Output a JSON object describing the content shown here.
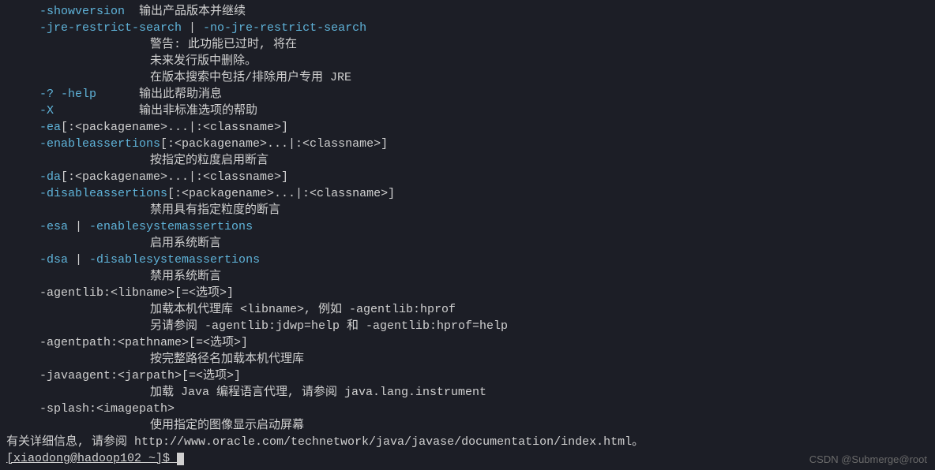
{
  "lines": [
    {
      "cls": "indent1",
      "parts": [
        {
          "c": "opt",
          "t": "-showversion"
        },
        {
          "c": "norm",
          "t": "  输出产品版本并继续"
        }
      ]
    },
    {
      "cls": "indent1",
      "parts": [
        {
          "c": "opt",
          "t": "-jre-restrict-search"
        },
        {
          "c": "norm",
          "t": " | "
        },
        {
          "c": "opt",
          "t": "-no-jre-restrict-search"
        }
      ]
    },
    {
      "cls": "indent2",
      "parts": [
        {
          "c": "norm",
          "t": "警告: 此功能已过时, 将在"
        }
      ]
    },
    {
      "cls": "indent2",
      "parts": [
        {
          "c": "norm",
          "t": "未来发行版中删除。"
        }
      ]
    },
    {
      "cls": "indent2",
      "parts": [
        {
          "c": "norm",
          "t": "在版本搜索中包括/排除用户专用 JRE"
        }
      ]
    },
    {
      "cls": "indent1",
      "parts": [
        {
          "c": "opt",
          "t": "-? -help"
        },
        {
          "c": "norm",
          "t": "      输出此帮助消息"
        }
      ]
    },
    {
      "cls": "indent1",
      "parts": [
        {
          "c": "opt",
          "t": "-X"
        },
        {
          "c": "norm",
          "t": "            输出非标准选项的帮助"
        }
      ]
    },
    {
      "cls": "indent1",
      "parts": [
        {
          "c": "opt",
          "t": "-ea"
        },
        {
          "c": "norm",
          "t": "[:<packagename>...|:<classname>]"
        }
      ]
    },
    {
      "cls": "indent1",
      "parts": [
        {
          "c": "opt",
          "t": "-enableassertions"
        },
        {
          "c": "norm",
          "t": "[:<packagename>...|:<classname>]"
        }
      ]
    },
    {
      "cls": "indent2",
      "parts": [
        {
          "c": "norm",
          "t": "按指定的粒度启用断言"
        }
      ]
    },
    {
      "cls": "indent1",
      "parts": [
        {
          "c": "opt",
          "t": "-da"
        },
        {
          "c": "norm",
          "t": "[:<packagename>...|:<classname>]"
        }
      ]
    },
    {
      "cls": "indent1",
      "parts": [
        {
          "c": "opt",
          "t": "-disableassertions"
        },
        {
          "c": "norm",
          "t": "[:<packagename>...|:<classname>]"
        }
      ]
    },
    {
      "cls": "indent2",
      "parts": [
        {
          "c": "norm",
          "t": "禁用具有指定粒度的断言"
        }
      ]
    },
    {
      "cls": "indent1",
      "parts": [
        {
          "c": "opt",
          "t": "-esa"
        },
        {
          "c": "norm",
          "t": " | "
        },
        {
          "c": "opt",
          "t": "-enablesystemassertions"
        }
      ]
    },
    {
      "cls": "indent2",
      "parts": [
        {
          "c": "norm",
          "t": "启用系统断言"
        }
      ]
    },
    {
      "cls": "indent1",
      "parts": [
        {
          "c": "opt",
          "t": "-dsa"
        },
        {
          "c": "norm",
          "t": " | "
        },
        {
          "c": "opt",
          "t": "-disablesystemassertions"
        }
      ]
    },
    {
      "cls": "indent2",
      "parts": [
        {
          "c": "norm",
          "t": "禁用系统断言"
        }
      ]
    },
    {
      "cls": "indent1",
      "parts": [
        {
          "c": "norm",
          "t": "-agentlib:<libname>[=<选项>]"
        }
      ]
    },
    {
      "cls": "indent2",
      "parts": [
        {
          "c": "norm",
          "t": "加载本机代理库 <libname>, 例如 -agentlib:hprof"
        }
      ]
    },
    {
      "cls": "indent2",
      "parts": [
        {
          "c": "norm",
          "t": "另请参阅 -agentlib:jdwp=help 和 -agentlib:hprof=help"
        }
      ]
    },
    {
      "cls": "indent1",
      "parts": [
        {
          "c": "norm",
          "t": "-agentpath:<pathname>[=<选项>]"
        }
      ]
    },
    {
      "cls": "indent2",
      "parts": [
        {
          "c": "norm",
          "t": "按完整路径名加载本机代理库"
        }
      ]
    },
    {
      "cls": "indent1",
      "parts": [
        {
          "c": "norm",
          "t": "-javaagent:<jarpath>[=<选项>]"
        }
      ]
    },
    {
      "cls": "indent2",
      "parts": [
        {
          "c": "norm",
          "t": "加载 Java 编程语言代理, 请参阅 java.lang.instrument"
        }
      ]
    },
    {
      "cls": "indent1",
      "parts": [
        {
          "c": "norm",
          "t": "-splash:<imagepath>"
        }
      ]
    },
    {
      "cls": "indent2",
      "parts": [
        {
          "c": "norm",
          "t": "使用指定的图像显示启动屏幕"
        }
      ]
    },
    {
      "cls": "indent0",
      "parts": [
        {
          "c": "norm",
          "t": "有关详细信息, 请参阅 http://www.oracle.com/technetwork/java/javase/documentation/index.html。"
        }
      ]
    }
  ],
  "prompt": "[xiaodong@hadoop102 ~]$ ",
  "watermark": "CSDN @Submerge@root"
}
